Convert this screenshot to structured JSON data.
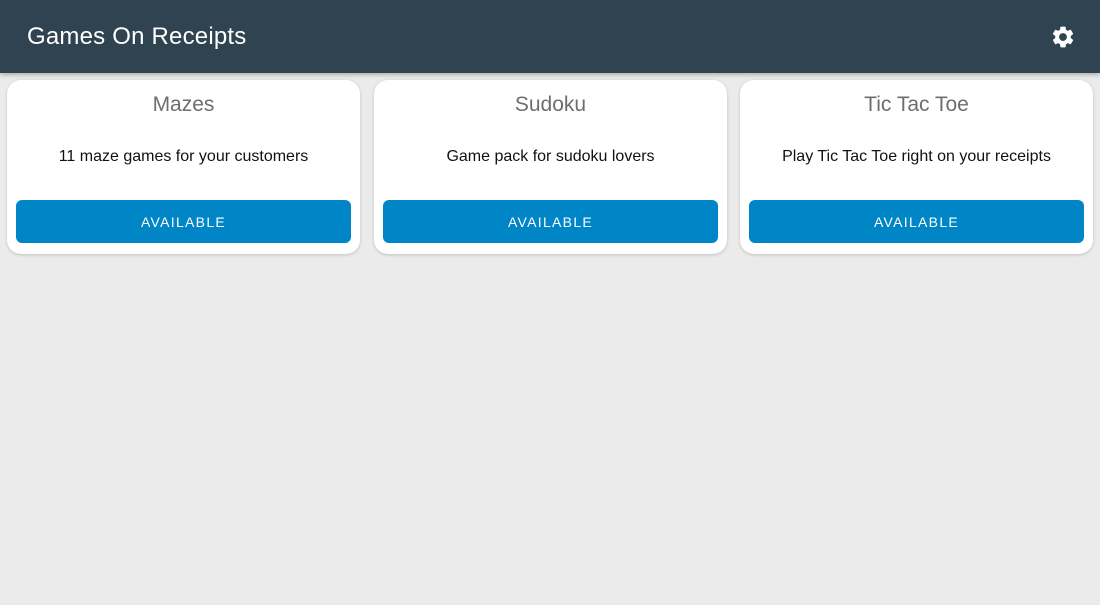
{
  "header": {
    "title": "Games On Receipts",
    "settings_icon": "gear-icon"
  },
  "colors": {
    "app_bar": "#2f4351",
    "background": "#ebebeb",
    "button": "#0085c7"
  },
  "games": [
    {
      "title": "Mazes",
      "description": "11 maze games for your customers",
      "button_label": "AVAILABLE"
    },
    {
      "title": "Sudoku",
      "description": "Game pack for sudoku lovers",
      "button_label": "AVAILABLE"
    },
    {
      "title": "Tic Tac Toe",
      "description": "Play Tic Tac Toe right on your receipts",
      "button_label": "AVAILABLE"
    }
  ]
}
